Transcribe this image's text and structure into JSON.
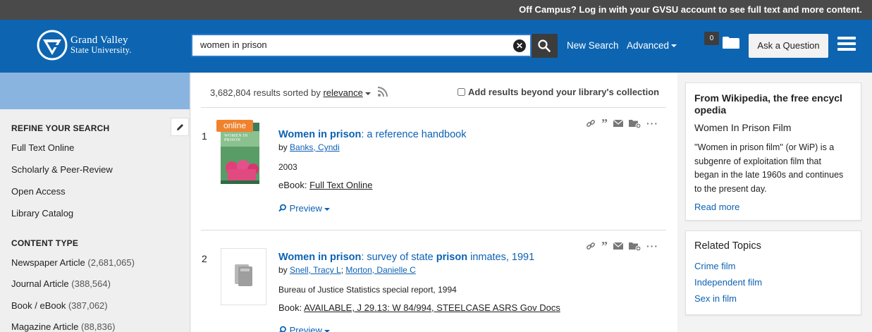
{
  "topbar": {
    "notice": "Off Campus? Log in with your GVSU account to see full text and more content."
  },
  "header": {
    "logo_line1": "Grand Valley",
    "logo_line2": "State University.",
    "search_value": "women in prison",
    "new_search": "New Search",
    "advanced": "Advanced",
    "folder_count": "0",
    "ask": "Ask a Question"
  },
  "sidebar": {
    "refine_heading": "REFINE YOUR SEARCH",
    "refine_items": [
      "Full Text Online",
      "Scholarly & Peer-Review",
      "Open Access",
      "Library Catalog"
    ],
    "content_type_heading": "CONTENT TYPE",
    "content_types": [
      {
        "label": "Newspaper Article",
        "count": "(2,681,065)"
      },
      {
        "label": "Journal Article",
        "count": "(388,564)"
      },
      {
        "label": "Book / eBook",
        "count": "(387,062)"
      },
      {
        "label": "Magazine Article",
        "count": "(88,836)"
      }
    ]
  },
  "results_bar": {
    "count_text": "3,682,804 results sorted by",
    "sort": "relevance",
    "beyond": "Add results beyond your library's collection"
  },
  "results": [
    {
      "num": "1",
      "badge": "online",
      "cover_title": "WOMEN IN PRISON",
      "title_match": "Women in prison",
      "title_rest": ": a reference handbook",
      "by": "by",
      "authors": [
        "Banks, Cyndi"
      ],
      "year": "2003",
      "format_label": "eBook:",
      "format_value": "Full Text Online",
      "preview": "Preview"
    },
    {
      "num": "2",
      "title_match": "Women in prison",
      "title_mid": ": survey of state ",
      "title_match2": "prison",
      "title_rest": " inmates, 1991",
      "by": "by",
      "authors": [
        "Snell, Tracy L",
        "Morton, Danielle C"
      ],
      "series": "Bureau of Justice Statistics special report, 1994",
      "format_label": "Book:",
      "format_value": "AVAILABLE, J 29.13: W 84/994, STEELCASE ASRS Gov Docs",
      "preview": "Preview"
    }
  ],
  "wiki": {
    "heading": "From Wikipedia, the free encyclopedia",
    "heading_line1": "From Wikipedia, the free encycl",
    "heading_line2": "opedia",
    "subtitle": "Women In Prison Film",
    "text_lines": [
      "''Women in prison film'' (or WiP) is a",
      "subgenre of exploitation film that",
      "began in the late 1960s and continues",
      "to the present day."
    ],
    "read_more": "Read more"
  },
  "related": {
    "heading": "Related Topics",
    "items": [
      "Crime film",
      "Independent film",
      "Sex in film"
    ]
  },
  "colors": {
    "header": "#0d65b1",
    "link": "#0c62b3",
    "topbar": "#4a4a4a",
    "badge_online": "#f0822d"
  }
}
